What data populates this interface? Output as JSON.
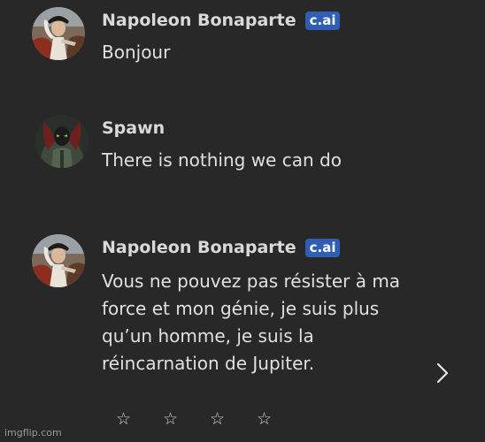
{
  "messages": [
    {
      "author": "Napoleon Bonaparte",
      "badge": "c.ai",
      "text": "Bonjour",
      "avatar_icon": "napoleon-portrait"
    },
    {
      "author": "Spawn",
      "text": "There is nothing we can do",
      "avatar_icon": "spawn-portrait"
    },
    {
      "author": "Napoleon Bonaparte",
      "badge": "c.ai",
      "text_lines": [
        "Vous ne pouvez pas résister à ma",
        "force et mon génie, je suis plus",
        "qu’un homme, je suis la",
        "réincarnation de Jupiter."
      ],
      "avatar_icon": "napoleon-portrait"
    }
  ],
  "rating": {
    "stars": [
      "☆",
      "☆",
      "☆",
      "☆"
    ]
  },
  "next_icon": "chevron-right-icon",
  "watermark": "imgflip.com",
  "colors": {
    "background": "#282828",
    "badge": "#2f5fb3",
    "text": "#e0e0e0"
  }
}
